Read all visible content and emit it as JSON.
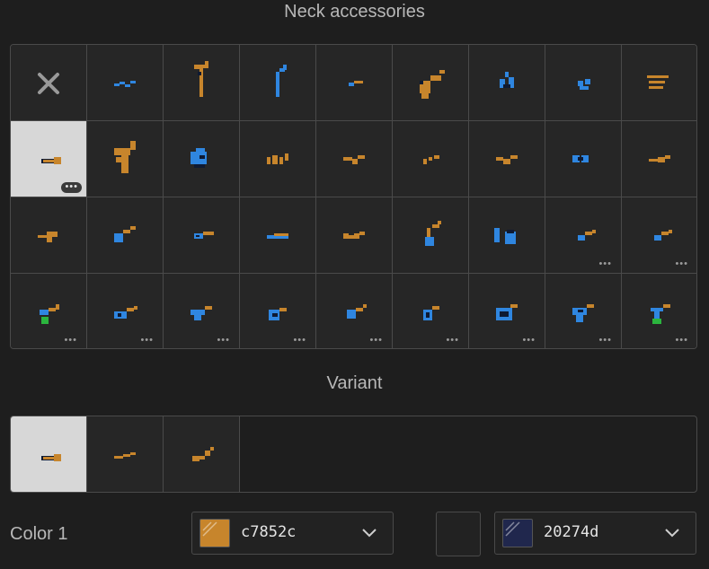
{
  "neck_title": "Neck accessories",
  "variant_title": "Variant",
  "color1_label": "Color 1",
  "color1": {
    "hex": "c7852c",
    "color": "#c7852c"
  },
  "color2": {
    "hex": "20274d",
    "color": "#20274d"
  },
  "icons": {
    "more": "ellipsis-icon",
    "chevron": "chevron-down-icon",
    "none": "close-icon"
  },
  "palette": {
    "orange": "#c7852c",
    "blue": "#2f86e0",
    "green": "#2bb53e"
  },
  "accessories": [
    {
      "name": "none",
      "more": false,
      "selected": false
    },
    {
      "name": "accessory-1",
      "more": false
    },
    {
      "name": "accessory-2",
      "more": false
    },
    {
      "name": "accessory-3",
      "more": false
    },
    {
      "name": "accessory-4",
      "more": false
    },
    {
      "name": "accessory-5",
      "more": false
    },
    {
      "name": "accessory-6",
      "more": false
    },
    {
      "name": "accessory-7",
      "more": false
    },
    {
      "name": "accessory-8",
      "more": false
    },
    {
      "name": "accessory-9",
      "more": true,
      "selected": true
    },
    {
      "name": "accessory-10",
      "more": false
    },
    {
      "name": "accessory-11",
      "more": false
    },
    {
      "name": "accessory-12",
      "more": false
    },
    {
      "name": "accessory-13",
      "more": false
    },
    {
      "name": "accessory-14",
      "more": false
    },
    {
      "name": "accessory-15",
      "more": false
    },
    {
      "name": "accessory-16",
      "more": false
    },
    {
      "name": "accessory-17",
      "more": false
    },
    {
      "name": "accessory-18",
      "more": false
    },
    {
      "name": "accessory-19",
      "more": false
    },
    {
      "name": "accessory-20",
      "more": false
    },
    {
      "name": "accessory-21",
      "more": false
    },
    {
      "name": "accessory-22",
      "more": false
    },
    {
      "name": "accessory-23",
      "more": false
    },
    {
      "name": "accessory-24",
      "more": false
    },
    {
      "name": "accessory-25",
      "more": true
    },
    {
      "name": "accessory-26",
      "more": true
    },
    {
      "name": "accessory-27",
      "more": true
    },
    {
      "name": "accessory-28",
      "more": true
    },
    {
      "name": "accessory-29",
      "more": true
    },
    {
      "name": "accessory-30",
      "more": true
    },
    {
      "name": "accessory-31",
      "more": true
    },
    {
      "name": "accessory-32",
      "more": true
    },
    {
      "name": "accessory-33",
      "more": true
    },
    {
      "name": "accessory-34",
      "more": true
    },
    {
      "name": "accessory-35",
      "more": true
    }
  ],
  "variants": [
    {
      "name": "variant-1",
      "selected": true
    },
    {
      "name": "variant-2",
      "selected": false
    },
    {
      "name": "variant-3",
      "selected": false
    }
  ]
}
